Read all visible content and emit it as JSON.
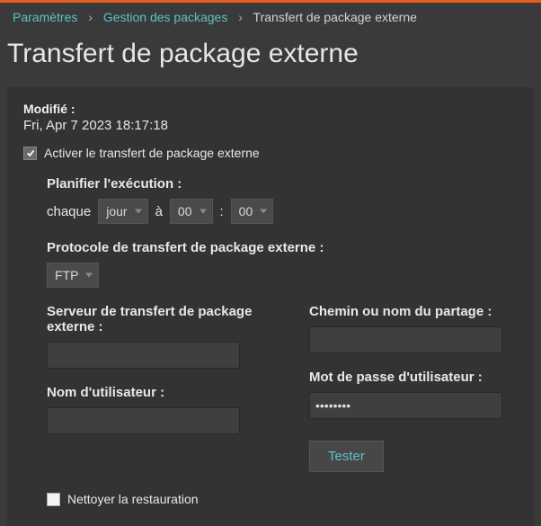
{
  "breadcrumb": {
    "root": "Paramètres",
    "mid": "Gestion des packages",
    "current": "Transfert de package externe"
  },
  "page_title": "Transfert de package externe",
  "modified": {
    "label": "Modifié :",
    "value": "Fri, Apr 7 2023 18:17:18"
  },
  "enable": {
    "label": "Activer le transfert de package externe",
    "checked": true
  },
  "schedule": {
    "label": "Planifier l'exécution :",
    "each": "chaque",
    "unit": "jour",
    "at": "à",
    "hour": "00",
    "sep": ":",
    "minute": "00"
  },
  "protocol": {
    "label": "Protocole de transfert de package externe :",
    "value": "FTP"
  },
  "server": {
    "label": "Serveur de transfert de package externe :",
    "value": ""
  },
  "share": {
    "label": "Chemin ou nom du partage :",
    "value": ""
  },
  "user": {
    "label": "Nom d'utilisateur :",
    "value": ""
  },
  "pass": {
    "label": "Mot de passe d'utilisateur :",
    "value": "••••••••"
  },
  "test_btn": "Tester",
  "cleanup": {
    "label": "Nettoyer la restauration",
    "checked": false
  }
}
